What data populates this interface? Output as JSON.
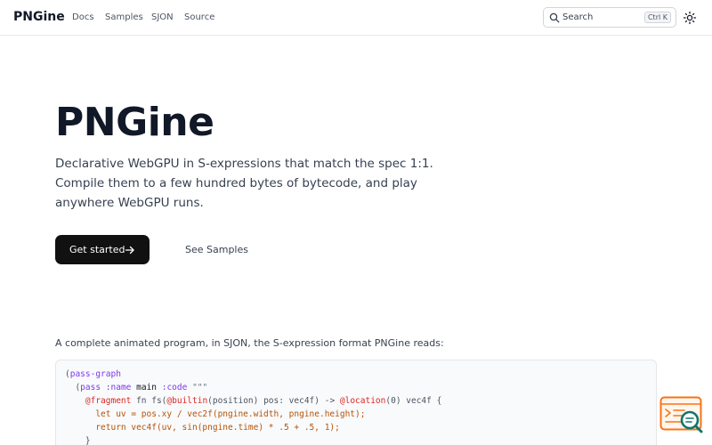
{
  "brand": "PNGine",
  "nav": {
    "docs": "Docs",
    "samples": "Samples",
    "sjon": "SJON",
    "source": "Source"
  },
  "search": {
    "label": "Search",
    "shortcut": "Ctrl K"
  },
  "hero": {
    "title": "PNGine",
    "description": "Declarative WebGPU in S-expressions that match the spec 1:1. Compile them to a few hundred bytes of bytecode, and play anywhere WebGPU runs.",
    "primary_button": "Get started",
    "secondary_button": "See Samples"
  },
  "intro": "A complete animated program, in SJON, the S-expression format PNGine reads:",
  "code": {
    "l1_open": "(",
    "l1_kw": "pass-graph",
    "l2_indent": "  (",
    "l2_kw": "pass",
    "l2_kw2": ":name",
    "l2_val": " main ",
    "l2_kw3": ":code",
    "l2_str": " \"\"\"",
    "l3_at": "    @fragment",
    "l3_rest": " fn fs(",
    "l3_at2": "@builtin",
    "l3_rest2": "(position) pos: vec4f) -> ",
    "l3_at3": "@location",
    "l3_rest3": "(0) vec4f {",
    "l4": "      let uv = pos.xy / vec2f(pngine.width, pngine.height);",
    "l5": "      return vec4f(uv, sin(pngine.time) * .5 + .5, 1);",
    "l6": "    }"
  },
  "colors": {
    "primary_button_bg": "#111111",
    "text": "#111827",
    "muted": "#374151",
    "widget_orange": "#f97316",
    "widget_teal": "#0f766e"
  },
  "icons": {
    "search": "search-icon",
    "theme": "sun-icon",
    "arrow": "arrow-right-icon",
    "widget": "chat-search-icon"
  }
}
